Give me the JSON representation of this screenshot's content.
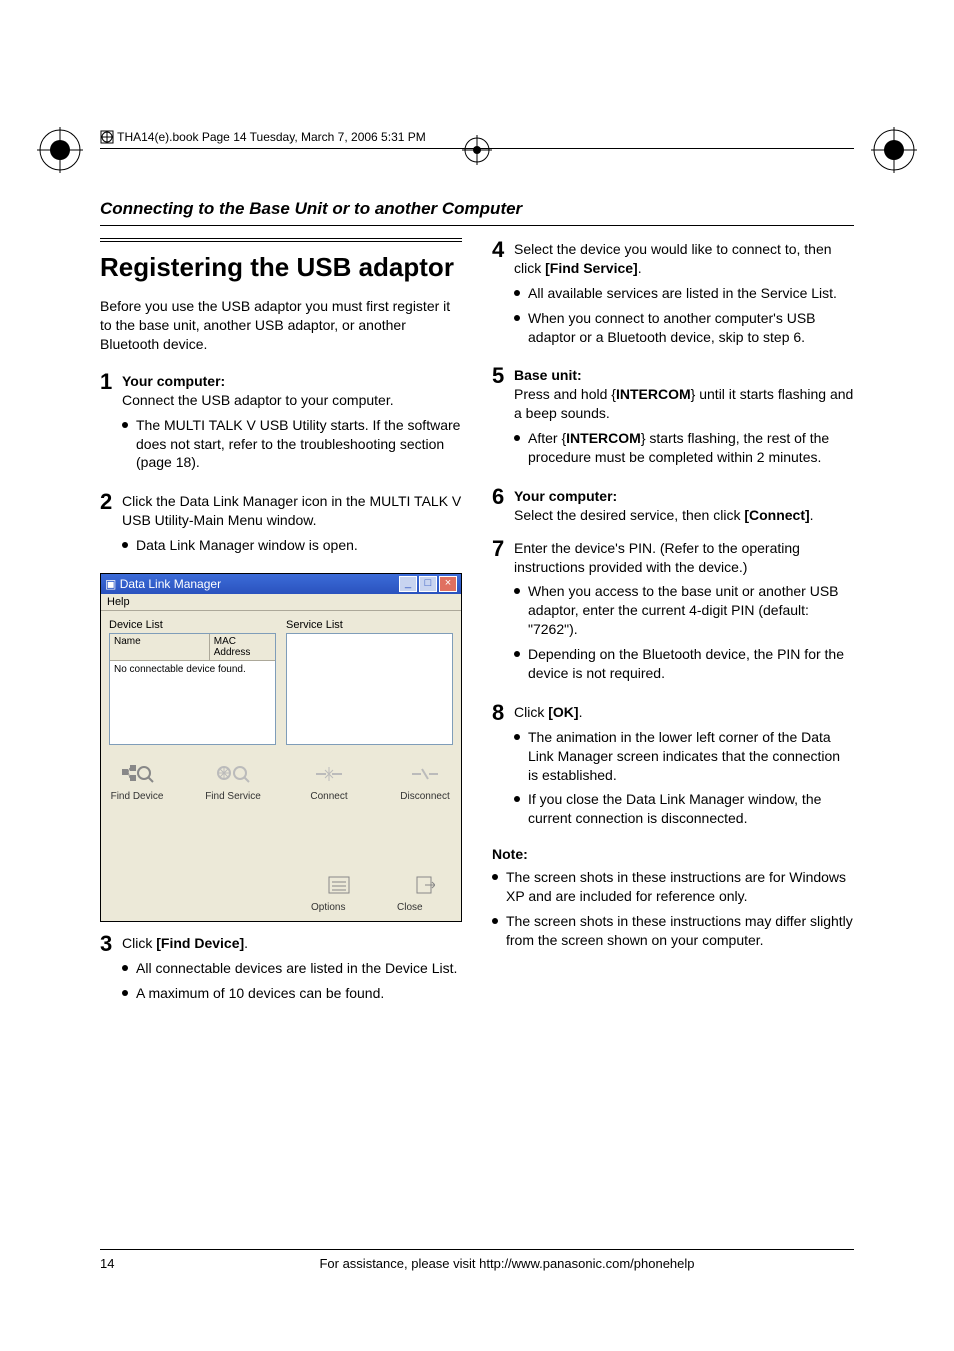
{
  "header_line": "THA14(e).book  Page 14  Tuesday, March 7, 2006  5:31 PM",
  "section_header": "Connecting to the Base Unit or to another Computer",
  "title": "Registering the USB adaptor",
  "intro": "Before you use the USB adaptor you must first register it to the base unit, another USB adaptor, or another Bluetooth device.",
  "left_steps": {
    "s1": {
      "num": "1",
      "lead_bold": "Your computer:",
      "lead": "Connect the USB adaptor to your computer.",
      "sub1": "The MULTI TALK V USB Utility starts. If the software does not start, refer to the troubleshooting section (page 18)."
    },
    "s2": {
      "num": "2",
      "lead": "Click the Data Link Manager icon in the MULTI TALK V USB Utility-Main Menu window.",
      "sub1": "Data Link Manager window is open."
    },
    "s3": {
      "num": "3",
      "lead_pre": "Click ",
      "lead_btn": "[Find Device]",
      "lead_post": ".",
      "sub1": "All connectable devices are listed in the Device List.",
      "sub2": "A maximum of 10 devices can be found."
    }
  },
  "right_steps": {
    "s4": {
      "num": "4",
      "lead_pre": "Select the device you would like to connect to, then click ",
      "lead_btn": "[Find Service]",
      "lead_post": ".",
      "sub1": "All available services are listed in the Service List.",
      "sub2": "When you connect to another computer's USB adaptor or a Bluetooth device, skip to step 6."
    },
    "s5": {
      "num": "5",
      "lead_bold": "Base unit:",
      "lead_pre": "Press and hold ",
      "lead_hw": "INTERCOM",
      "lead_post": " until it starts flashing and a beep sounds.",
      "sub1_pre": "After ",
      "sub1_hw": "INTERCOM",
      "sub1_post": " starts flashing, the rest of the procedure must be completed within 2 minutes."
    },
    "s6": {
      "num": "6",
      "lead_bold": "Your computer:",
      "lead_pre": "Select the desired service, then click ",
      "lead_btn": "[Connect]",
      "lead_post": "."
    },
    "s7": {
      "num": "7",
      "lead": "Enter the device's PIN. (Refer to the operating instructions provided with the device.)",
      "sub1": "When you access to the base unit or another USB adaptor, enter the current 4-digit PIN (default: \"7262\").",
      "sub2": "Depending on the Bluetooth device, the PIN for the device is not required."
    },
    "s8": {
      "num": "8",
      "lead_pre": "Click ",
      "lead_btn": "[OK]",
      "lead_post": ".",
      "sub1": "The animation in the lower left corner of the Data Link Manager screen indicates that the connection is established.",
      "sub2": "If you close the Data Link Manager window, the current connection is disconnected."
    }
  },
  "note": {
    "head": "Note:",
    "n1": "The screen shots in these instructions are for Windows XP and are included for reference only.",
    "n2": "The screen shots in these instructions may differ slightly from the screen shown on your computer."
  },
  "app": {
    "title": "Data Link Manager",
    "menu_help": "Help",
    "device_list_label": "Device List",
    "service_list_label": "Service List",
    "col_name": "Name",
    "col_mac": "MAC Address",
    "empty_msg": "No connectable device found.",
    "btn_find_device": "Find Device",
    "btn_find_service": "Find Service",
    "btn_connect": "Connect",
    "btn_disconnect": "Disconnect",
    "btn_options": "Options",
    "btn_close": "Close"
  },
  "footer": {
    "page": "14",
    "text": "For assistance, please visit http://www.panasonic.com/phonehelp"
  }
}
